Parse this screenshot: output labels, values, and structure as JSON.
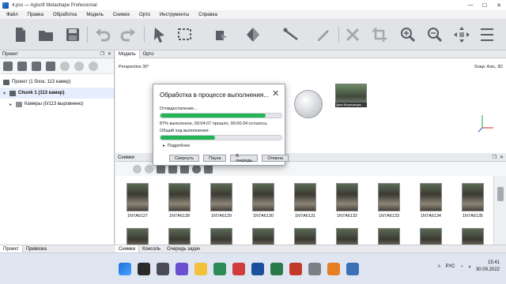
{
  "window": {
    "title": "4.psx — Agisoft Metashape Professional"
  },
  "menu": [
    "Файл",
    "Правка",
    "Обработка",
    "Модель",
    "Снимок",
    "Орто",
    "Инструменты",
    "Справка"
  ],
  "project_panel": {
    "title": "Проект",
    "tree": [
      {
        "label": "Проект (1 блок, 113 камер)"
      },
      {
        "label": "Chunk 1 (113 камер)"
      },
      {
        "label": "Камеры (0/113 выровнено)"
      }
    ]
  },
  "model_tabs": [
    "Модель",
    "Орто"
  ],
  "model_view": {
    "projection": "Perspective 30°",
    "snap": "Snap: Axis, 3D",
    "thumb_caption": "Диск Жерновщик"
  },
  "photos_panel": {
    "title": "Снимки",
    "photos": [
      {
        "label": "1N7A6127"
      },
      {
        "label": "1N7A6128"
      },
      {
        "label": "1N7A6129"
      },
      {
        "label": "1N7A6130"
      },
      {
        "label": "1N7A6131"
      },
      {
        "label": "1N7A6132"
      },
      {
        "label": "1N7A6133"
      },
      {
        "label": "1N7A6134"
      },
      {
        "label": "1N7A6135"
      }
    ]
  },
  "left_bottom_tabs": [
    "Проект",
    "Привязка"
  ],
  "right_bottom_tabs": [
    "Снимки",
    "Консоль",
    "Очередь задач"
  ],
  "dialog": {
    "title": "Обработка в процессе выполнения...",
    "task": "Отождествление...",
    "task_progress": 0.87,
    "status": "87% выполнено, 00:04:07 прошло, 00:00:34 осталось",
    "overall_label": "Общий ход выполнения:",
    "overall_progress": 0.45,
    "details": "Подробнее",
    "buttons": {
      "minimize": "Свернуть",
      "pause": "Пауза",
      "queue": "В очередь",
      "cancel": "Отмена"
    }
  },
  "taskbar": {
    "lang": "РУС",
    "time": "15:41",
    "date": "30.09.2022"
  },
  "colors": {
    "progress": "#22b455",
    "accent": "#1b4f9c"
  }
}
